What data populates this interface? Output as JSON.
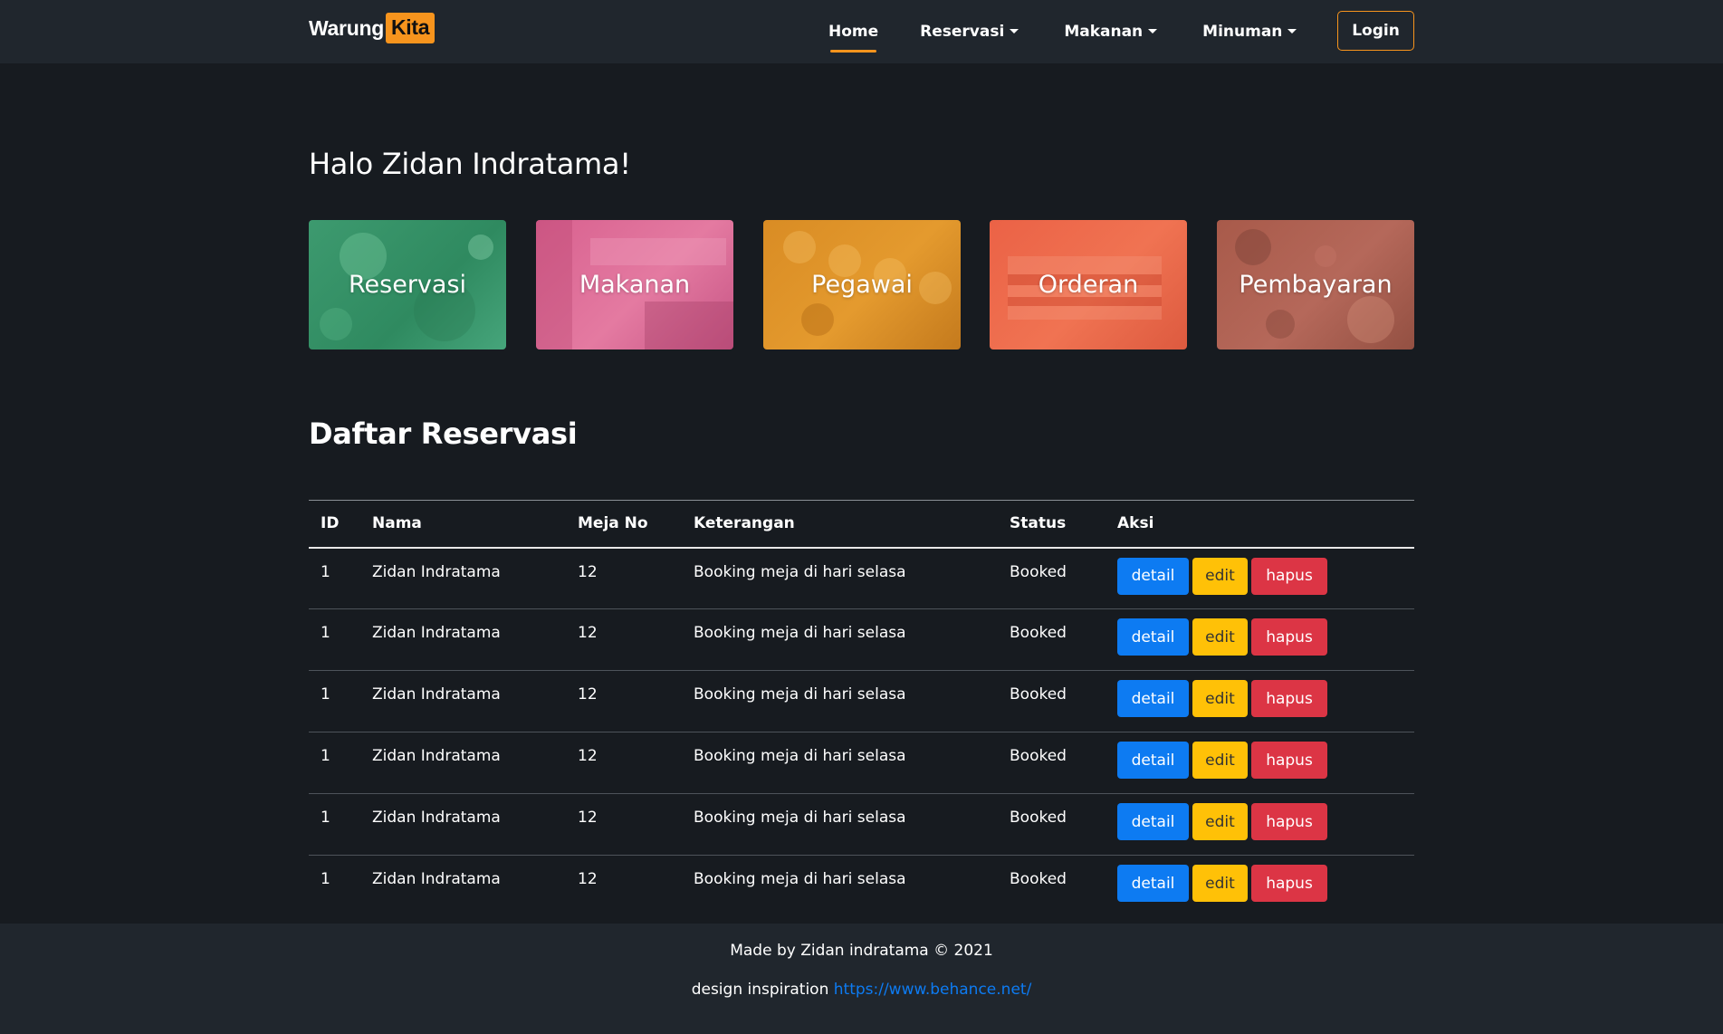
{
  "navbar": {
    "brand_part1": "Warung",
    "brand_part2": "Kita",
    "links": [
      {
        "label": "Home",
        "active": true,
        "dropdown": false
      },
      {
        "label": "Reservasi",
        "active": false,
        "dropdown": true
      },
      {
        "label": "Makanan",
        "active": false,
        "dropdown": true
      },
      {
        "label": "Minuman",
        "active": false,
        "dropdown": true
      }
    ],
    "login_label": "Login"
  },
  "greeting": "Halo Zidan Indratama!",
  "cards": [
    {
      "label": "Reservasi",
      "color": "#3d9a6f"
    },
    {
      "label": "Makanan",
      "color": "#d8618f"
    },
    {
      "label": "Pegawai",
      "color": "#d98c24"
    },
    {
      "label": "Orderan",
      "color": "#eb6246"
    },
    {
      "label": "Pembayaran",
      "color": "#a85a4a"
    }
  ],
  "section_title": "Daftar Reservasi",
  "table": {
    "headers": [
      "ID",
      "Nama",
      "Meja No",
      "Keterangan",
      "Status",
      "Aksi"
    ],
    "rows": [
      {
        "id": "1",
        "nama": "Zidan Indratama",
        "meja": "12",
        "keterangan": "Booking meja di hari selasa",
        "status": "Booked"
      },
      {
        "id": "1",
        "nama": "Zidan Indratama",
        "meja": "12",
        "keterangan": "Booking meja di hari selasa",
        "status": "Booked"
      },
      {
        "id": "1",
        "nama": "Zidan Indratama",
        "meja": "12",
        "keterangan": "Booking meja di hari selasa",
        "status": "Booked"
      },
      {
        "id": "1",
        "nama": "Zidan Indratama",
        "meja": "12",
        "keterangan": "Booking meja di hari selasa",
        "status": "Booked"
      },
      {
        "id": "1",
        "nama": "Zidan Indratama",
        "meja": "12",
        "keterangan": "Booking meja di hari selasa",
        "status": "Booked"
      },
      {
        "id": "1",
        "nama": "Zidan Indratama",
        "meja": "12",
        "keterangan": "Booking meja di hari selasa",
        "status": "Booked"
      }
    ],
    "actions": {
      "detail": "detail",
      "edit": "edit",
      "hapus": "hapus"
    }
  },
  "footer": {
    "credit": "Made by Zidan indratama © 2021",
    "inspiration_label": "design inspiration",
    "inspiration_link": "https://www.behance.net/"
  },
  "colors": {
    "accent": "#f7941d",
    "navbar_bg": "#20262d",
    "page_bg": "#171b20",
    "detail": "#0d7bf2",
    "edit": "#ffc107",
    "hapus": "#dc3545"
  }
}
